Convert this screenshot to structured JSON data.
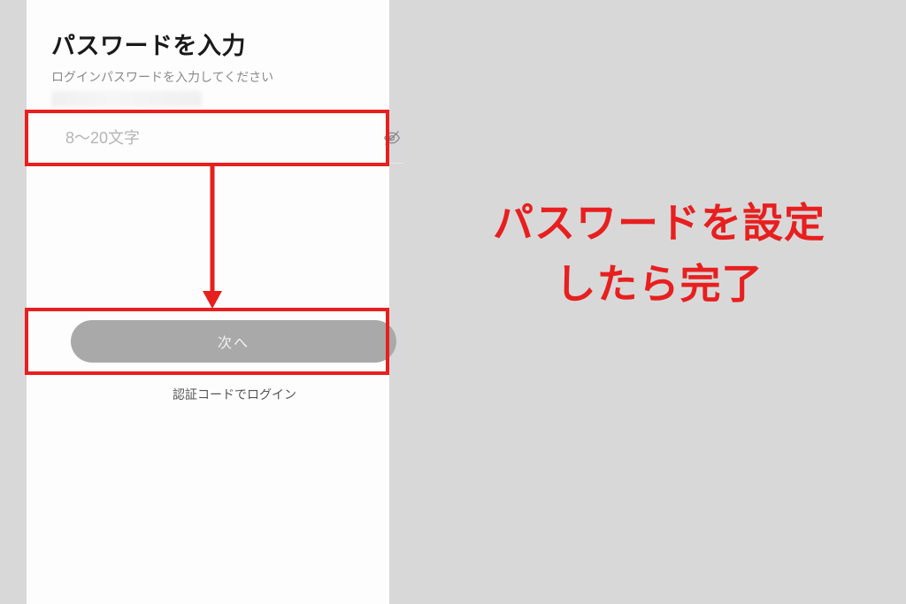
{
  "screen": {
    "title": "パスワードを入力",
    "subtitle": "ログインパスワードを入力してください",
    "password_placeholder": "8〜20文字",
    "next_button_label": "次へ",
    "alt_login_label": "認証コードでログイン"
  },
  "annotation": {
    "line1": "パスワードを設定",
    "line2": "したら完了"
  },
  "colors": {
    "highlight": "#e81f1f",
    "button_bg": "#a9a9a9",
    "page_bg": "#d8d8d8",
    "screen_bg": "#fdfdfd"
  }
}
